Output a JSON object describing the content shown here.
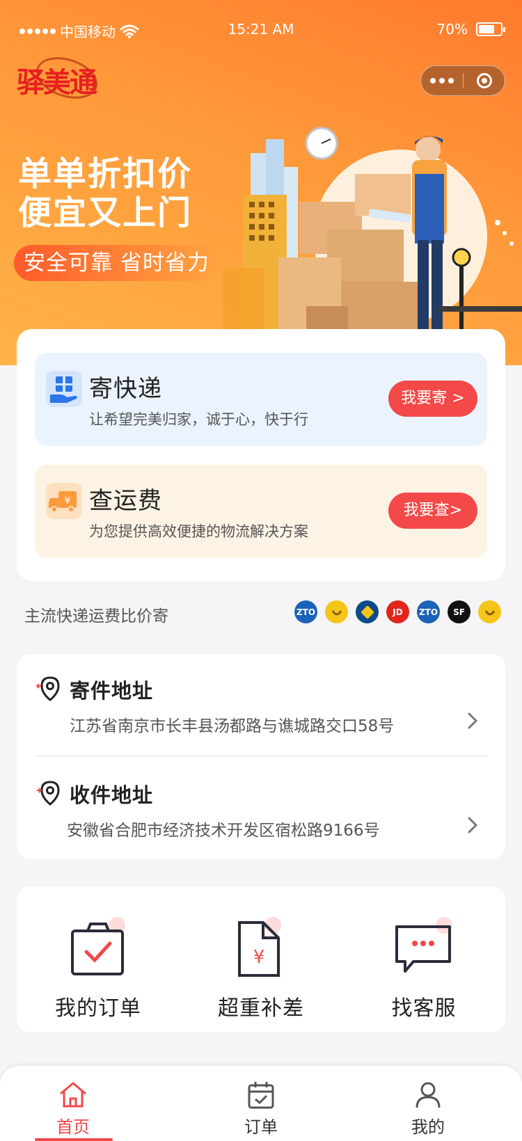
{
  "status_bar": {
    "carrier": "中国移动",
    "time": "15:21 AM",
    "battery": "70%"
  },
  "header": {
    "logo_text": "驿美通",
    "headline_line1": "单单折扣价",
    "headline_line2": "便宜又上门",
    "slogan": "安全可靠  省时省力"
  },
  "services": {
    "send": {
      "title": "寄快递",
      "desc": "让希望完美归家，诚于心，快于行",
      "button": "我要寄 >"
    },
    "fee": {
      "title": "查运费",
      "desc": "为您提供高效便捷的物流解决方案",
      "button": "我要查>"
    }
  },
  "compare": {
    "label": "主流快递运费比价寄",
    "carriers": [
      {
        "icon": "zto-logo",
        "text": "ZTO",
        "color": "#1a63b8"
      },
      {
        "icon": "smile-logo",
        "text": "",
        "color": "#f5c518"
      },
      {
        "icon": "yunda-logo",
        "text": "",
        "color": "#0d4a8a"
      },
      {
        "icon": "jd-logo",
        "text": "JD",
        "color": "#e1251b"
      },
      {
        "icon": "zto-logo",
        "text": "ZTO",
        "color": "#1a63b8"
      },
      {
        "icon": "sf-logo",
        "text": "SF",
        "color": "#111111"
      },
      {
        "icon": "smile-logo",
        "text": "",
        "color": "#f5c518"
      }
    ]
  },
  "addresses": {
    "from": {
      "label": "寄件地址",
      "text": "江苏省南京市长丰县汤都路与谯城路交口58号"
    },
    "to": {
      "label": "收件地址",
      "text": "安徽省合肥市经济技术开发区宿松路9166号"
    }
  },
  "tools": [
    {
      "icon": "order-clipboard-icon",
      "label": "我的订单"
    },
    {
      "icon": "yen-document-icon",
      "label": "超重补差"
    },
    {
      "icon": "chat-bubble-icon",
      "label": "找客服"
    }
  ],
  "tabbar": [
    {
      "icon": "home-icon",
      "label": "首页",
      "active": true
    },
    {
      "icon": "calendar-check-icon",
      "label": "订单",
      "active": false
    },
    {
      "icon": "user-icon",
      "label": "我的",
      "active": false
    }
  ],
  "colors": {
    "banner_orange": "#ff8a35",
    "accent_red": "#f34949",
    "send_bg": "#ebf3fe",
    "fee_bg": "#fdf3e4"
  }
}
